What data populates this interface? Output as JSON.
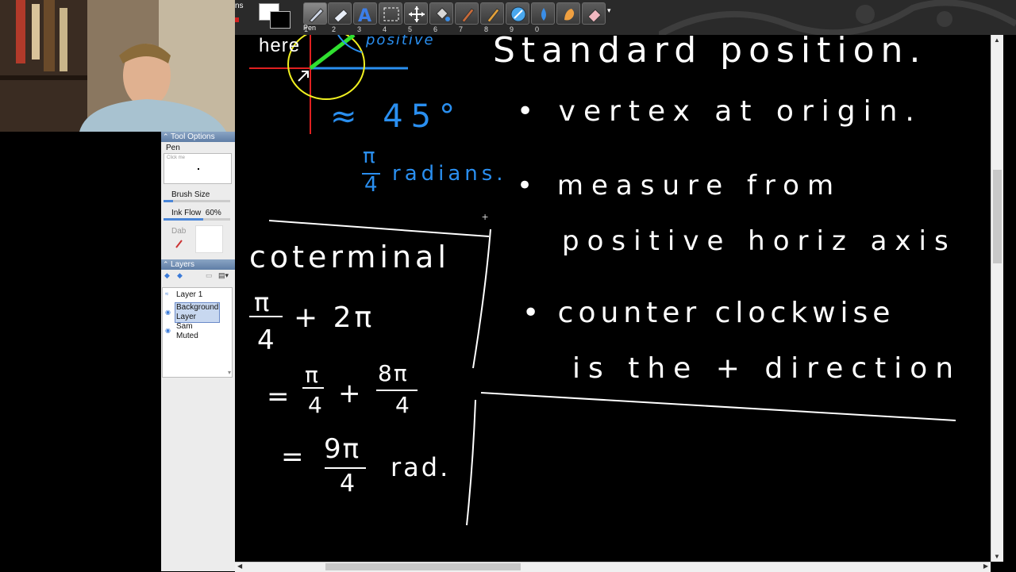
{
  "toolbar": {
    "partial_tab_text": "ns",
    "tools": [
      {
        "number": "1",
        "icon": "pen-icon"
      },
      {
        "number": "2",
        "icon": "highlighter-icon"
      },
      {
        "number": "3",
        "icon": "text-icon"
      },
      {
        "number": "4",
        "icon": "selection-icon"
      },
      {
        "number": "5",
        "icon": "move-icon"
      },
      {
        "number": "6",
        "icon": "paint-bucket-icon"
      },
      {
        "number": "7",
        "icon": "brush-icon"
      },
      {
        "number": "8",
        "icon": "marker-icon"
      },
      {
        "number": "9",
        "icon": "eyedropper-icon"
      },
      {
        "number": "0",
        "icon": "blur-icon"
      },
      {
        "number": "",
        "icon": "smudge-icon"
      },
      {
        "number": "",
        "icon": "eraser-icon"
      }
    ],
    "active_tool_label": "Pen"
  },
  "tool_options": {
    "title": "Tool Options",
    "tool_name": "Pen",
    "preview_hint": "Click me",
    "brush_size_label": "Brush Size",
    "ink_flow_label": "Ink Flow",
    "ink_flow_value": "60%",
    "dab_label": "Dab"
  },
  "layers": {
    "title": "Layers",
    "items": [
      {
        "name": "Layer 1",
        "selected": false
      },
      {
        "name": "Background Layer",
        "selected": true
      },
      {
        "name": "Sam Muted",
        "selected": false
      }
    ]
  },
  "board": {
    "corner_note": "here",
    "axis_positive": "positive",
    "approx_deg": "≈ 45°",
    "pi_over_4_num": "π",
    "pi_over_4_den": "4",
    "radians": "radians.",
    "heading": "Standard position.",
    "bullet1": "• vertex at origin.",
    "bullet2a": "• measure from",
    "bullet2b": "positive horiz axis",
    "bullet3a": "• counter clockwise",
    "bullet3b": "is the + direction",
    "coterminal": "coterminal",
    "eq1_num": "π",
    "eq1_den": "4",
    "eq1_rest": "+ 2π",
    "eq2_eq": "=",
    "eq2_a_num": "π",
    "eq2_a_den": "4",
    "eq2_plus": "+",
    "eq2_b_num": "8π",
    "eq2_b_den": "4",
    "eq3_eq": "=",
    "eq3_num": "9π",
    "eq3_den": "4",
    "eq3_unit": "rad."
  },
  "colors": {
    "ink_white": "#ffffff",
    "ink_blue": "#2a8ff0",
    "ink_red": "#e02020",
    "ink_yellow": "#f0f020",
    "ink_green": "#30e030"
  }
}
